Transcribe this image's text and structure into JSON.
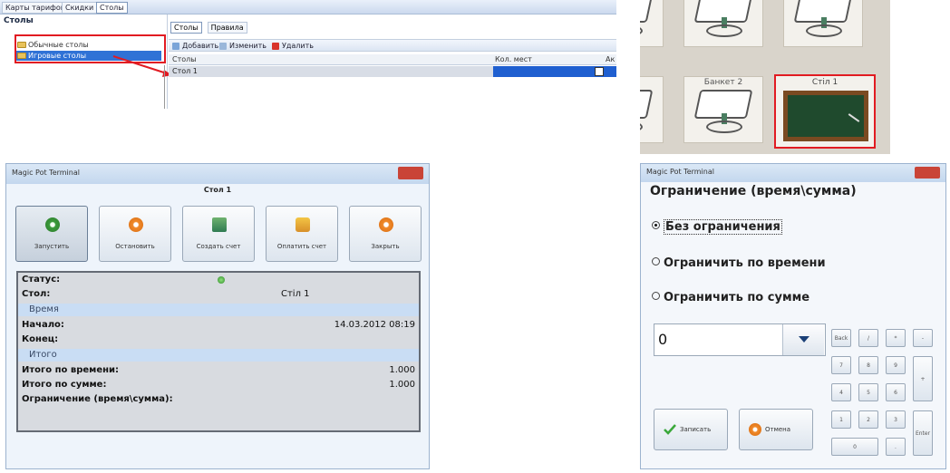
{
  "admin": {
    "tabs": [
      "Карты тарифов",
      "Скидки",
      "Столы"
    ],
    "tree_root": "Столы",
    "tree_items": [
      "Обычные столы",
      "Игровые столы"
    ],
    "subtabs": [
      "Столы",
      "Правила"
    ],
    "toolbar": [
      "Добавить",
      "Изменить",
      "Удалить"
    ],
    "grid_headers": [
      "Столы",
      "Кол. мест",
      "Ак"
    ],
    "row_name": "Стол 1"
  },
  "tables": {
    "tiles": [
      "",
      "",
      "",
      "",
      "Банкет 2"
    ],
    "highlighted": "Стіл 1"
  },
  "terminal": {
    "window_title": "Magic Pot Terminal",
    "table_title": "Стол 1",
    "buttons": [
      "Запустить",
      "Остановить",
      "Создать счет",
      "Оплатить счет",
      "Закрыть"
    ],
    "info": {
      "status_label": "Статус:",
      "table_label": "Стол:",
      "table_value": "Стіл 1",
      "time_group": "Время",
      "start_label": "Начало:",
      "start_value": "14.03.2012 08:19",
      "end_label": "Конец:",
      "total_group": "Итого",
      "total_time_label": "Итого по времени:",
      "total_time_value": "1.000",
      "total_sum_label": "Итого по сумме:",
      "total_sum_value": "1.000",
      "limit_label": "Ограничение (время\\сумма):"
    }
  },
  "limit_dialog": {
    "window_title": "Magic Pot Terminal",
    "title": "Ограничение (время\\сумма)",
    "options": [
      "Без ограничения",
      "Ограничить по времени",
      "Ограничить по сумме"
    ],
    "selected_option": "Без ограничения",
    "amount_value": "0",
    "keys": [
      "Back",
      "/",
      "*",
      "-",
      "7",
      "8",
      "9",
      "+",
      "4",
      "5",
      "6",
      "1",
      "2",
      "3",
      "Enter",
      "0",
      "."
    ],
    "save_label": "Записать",
    "cancel_label": "Отмена"
  },
  "colors": {
    "highlight_red": "#e11b22",
    "selection_blue": "#1f5fd0",
    "felt_green": "#1f4a2d",
    "info_header_blue": "#c9ddf4"
  }
}
